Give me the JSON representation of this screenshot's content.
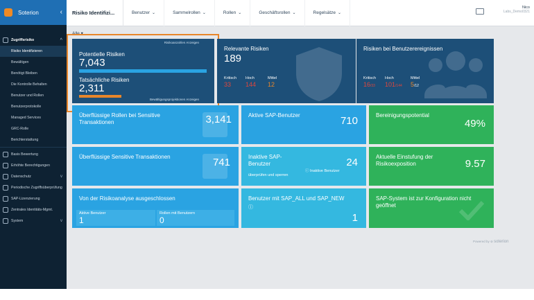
{
  "sidebar": {
    "brand": "Soterion",
    "collapse_icon": "‹",
    "section": "Zugriffsrisiko",
    "items": [
      {
        "label": "Risiko Identifizieren",
        "active": true
      },
      {
        "label": "Bewältigen"
      },
      {
        "label": "Benötigt Bleiben"
      },
      {
        "label": "Die Kontrolle Behalten"
      },
      {
        "label": "Benutzer und Rollen"
      },
      {
        "label": "Benutzerprotokolle"
      },
      {
        "label": "Managed Services"
      },
      {
        "label": "GRC-Rolle"
      },
      {
        "label": "Berichterstattung"
      }
    ],
    "top_items": [
      {
        "label": "Basis Bewertung",
        "has_chevron": false
      },
      {
        "label": "Erhöhte Berechtigungen",
        "has_chevron": false
      },
      {
        "label": "Datenschutz",
        "has_chevron": true
      },
      {
        "label": "Periodische Zugriffsüberprüfung",
        "has_chevron": false
      },
      {
        "label": "SAP-Lizenzierung",
        "has_chevron": false
      },
      {
        "label": "Zentrales Identitäts-Mgmt.",
        "has_chevron": false
      },
      {
        "label": "System",
        "has_chevron": true
      }
    ]
  },
  "header": {
    "title": "Risiko Identifizi...",
    "tabs": [
      "Benutzer",
      "Sammelrollen",
      "Rollen",
      "Geschäftsrollen",
      "Regelsätze"
    ],
    "user_name": "Nico",
    "user_sub": "Labs_Demo0321"
  },
  "main": {
    "filter": "Alle",
    "tiles": {
      "potential": {
        "title": "Potentielle Risiken",
        "value": "7,043",
        "link_top": "Risikoanzahlen Anzeigen",
        "actual_title": "Tatsächliche Risiken",
        "actual_value": "2,311",
        "link_bottom": "Bewältigungsprojektionen Anzeigen",
        "actual_fraction": 0.33
      },
      "relevant": {
        "title": "Relevante Risiken",
        "value": "189",
        "crit_label": "Kritisch",
        "crit_value": "33",
        "high_label": "Hoch",
        "high_value": "144",
        "mid_label": "Mittel",
        "mid_value": "12"
      },
      "events": {
        "title": "Risiken bei Benutzerereignissen",
        "crit_label": "Kritisch",
        "crit_value": "16",
        "crit_total": "/33",
        "high_label": "Hoch",
        "high_value": "101",
        "high_total": "/144",
        "mid_label": "Mittel",
        "mid_value": "5",
        "mid_total": "/12"
      },
      "roles_sensitive": {
        "title": "Überflüssige Rollen bei Sensitive Transaktionen",
        "value": "3,141"
      },
      "active_sap": {
        "title": "Aktive SAP-Benutzer",
        "value": "710"
      },
      "cleanup": {
        "title": "Bereinigungspotential",
        "value": "49%"
      },
      "sens_trans": {
        "title": "Überflüssige Sensitive Transaktionen",
        "value": "741"
      },
      "inactive": {
        "title": "Inaktive SAP-Benutzer",
        "sub": "überprüfen und sperren",
        "note": "Inaktive Benutzer",
        "value": "24"
      },
      "exposure": {
        "title": "Aktuelle Einstufung der Risikoexposition",
        "value": "9.57"
      },
      "excluded": {
        "title": "Von der Risikoanalyse ausgeschlossen",
        "left_label": "Aktive Benutzer",
        "left_value": "1",
        "right_label": "Rollen mit Benutzern",
        "right_value": "0"
      },
      "sap_all": {
        "title": "Benutzer mit SAP_ALL und SAP_NEW",
        "value": "1"
      },
      "config": {
        "title": "SAP-System ist zur Konfiguration nicht geöffnet"
      }
    },
    "footer": {
      "powered": "Powered by",
      "brand": "soterion"
    }
  },
  "colors": {
    "navy": "#1d4f78",
    "blue": "#2aa3e2",
    "green": "#2fb25a",
    "orange": "#e8862a",
    "red": "#e0463c",
    "accent": "#1f6fb4"
  }
}
